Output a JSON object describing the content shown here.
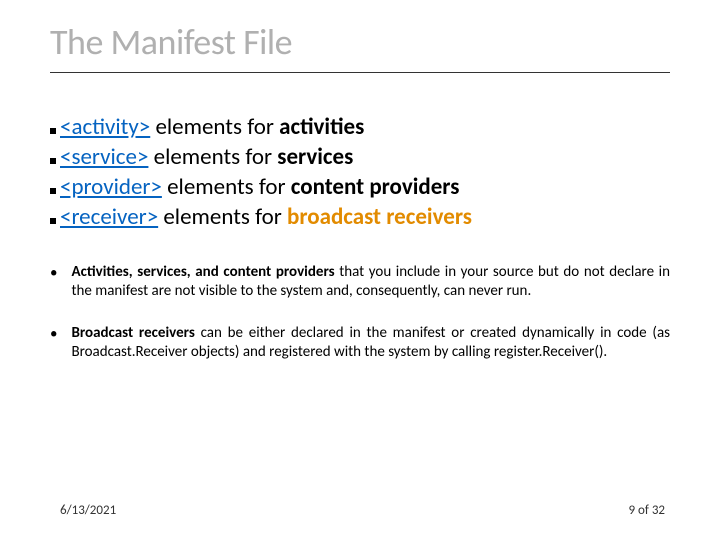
{
  "title": "The Manifest File",
  "elements": [
    {
      "link": "<activity>",
      "mid": " elements for ",
      "bold": "activities",
      "boldColor": "black"
    },
    {
      "link": "<service>",
      "mid": " elements for ",
      "bold": "services",
      "boldColor": "black"
    },
    {
      "link": "<provider>",
      "mid": " elements for ",
      "bold": "content providers",
      "boldColor": "black"
    },
    {
      "link": "<receiver>",
      "mid": " elements for ",
      "bold": "broadcast receivers",
      "boldColor": "orange"
    }
  ],
  "bullets": [
    {
      "bold": "Activities, services, and content providers",
      "rest": " that you include in your source but do not declare in the manifest are not visible to the system and, consequently, can never run."
    },
    {
      "bold": "Broadcast receivers",
      "rest": " can be either declared in the manifest or created dynamically in code (as Broadcast.Receiver objects) and registered with the system by calling register.Receiver()."
    }
  ],
  "footer": {
    "date": "6/13/2021",
    "page_current": "9",
    "page_sep": " of ",
    "page_total": "32"
  }
}
